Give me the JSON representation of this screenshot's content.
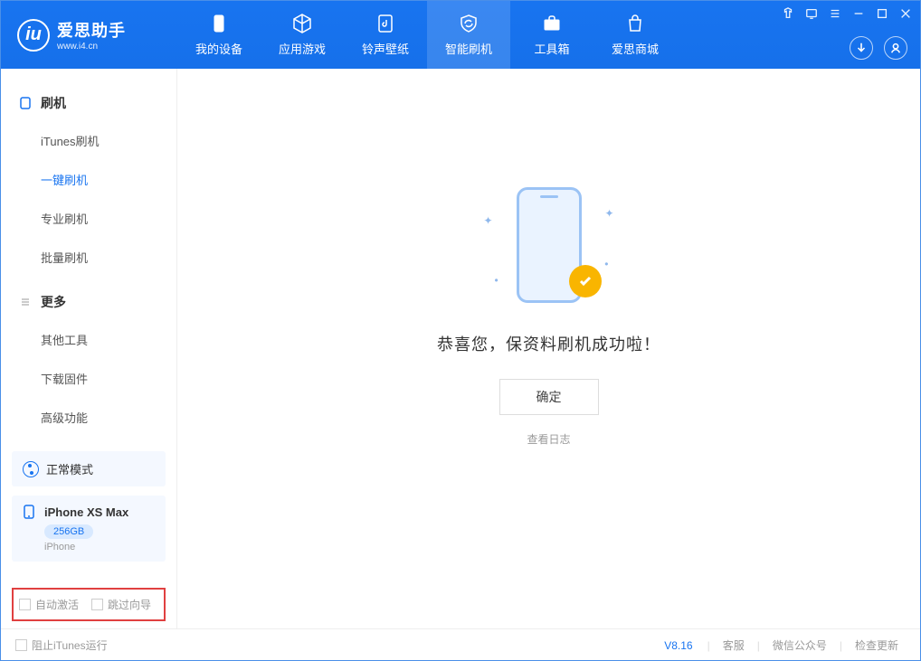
{
  "app": {
    "title": "爱思助手",
    "subtitle": "www.i4.cn"
  },
  "tabs": [
    {
      "label": "我的设备"
    },
    {
      "label": "应用游戏"
    },
    {
      "label": "铃声壁纸"
    },
    {
      "label": "智能刷机"
    },
    {
      "label": "工具箱"
    },
    {
      "label": "爱思商城"
    }
  ],
  "sidebar": {
    "section1": {
      "title": "刷机",
      "items": [
        "iTunes刷机",
        "一键刷机",
        "专业刷机",
        "批量刷机"
      ]
    },
    "section2": {
      "title": "更多",
      "items": [
        "其他工具",
        "下载固件",
        "高级功能"
      ]
    }
  },
  "mode": {
    "label": "正常模式"
  },
  "device": {
    "name": "iPhone XS Max",
    "storage": "256GB",
    "type": "iPhone"
  },
  "checkboxes": {
    "auto_activate": "自动激活",
    "skip_guide": "跳过向导"
  },
  "main": {
    "success_text": "恭喜您，保资料刷机成功啦！",
    "ok_button": "确定",
    "view_log": "查看日志"
  },
  "footer": {
    "block_itunes": "阻止iTunes运行",
    "version": "V8.16",
    "support": "客服",
    "wechat": "微信公众号",
    "check_update": "检查更新"
  }
}
